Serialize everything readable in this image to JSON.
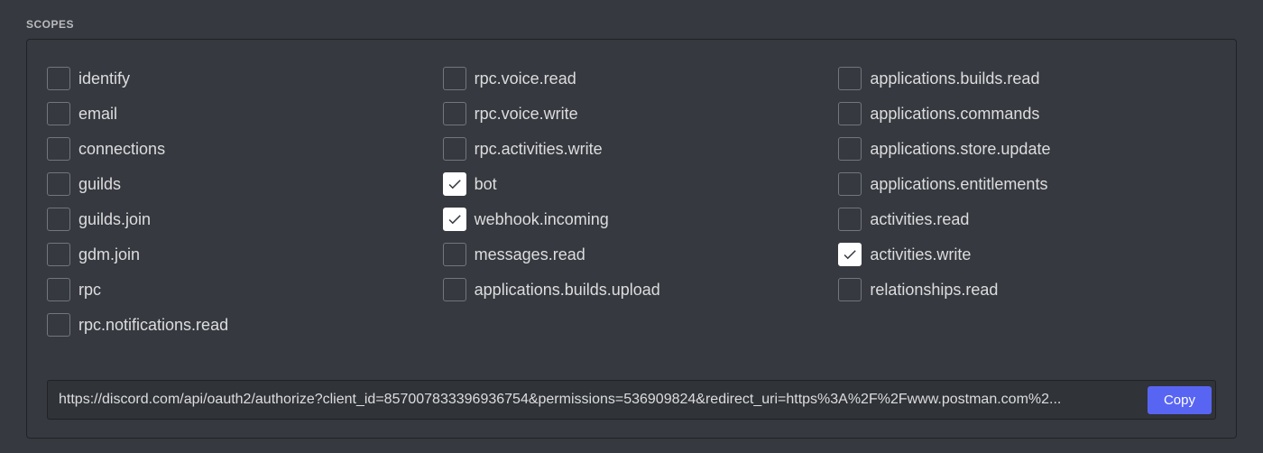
{
  "section_title": "SCOPES",
  "scopes": {
    "col1": [
      {
        "label": "identify",
        "checked": false
      },
      {
        "label": "email",
        "checked": false
      },
      {
        "label": "connections",
        "checked": false
      },
      {
        "label": "guilds",
        "checked": false
      },
      {
        "label": "guilds.join",
        "checked": false
      },
      {
        "label": "gdm.join",
        "checked": false
      },
      {
        "label": "rpc",
        "checked": false
      },
      {
        "label": "rpc.notifications.read",
        "checked": false
      }
    ],
    "col2": [
      {
        "label": "rpc.voice.read",
        "checked": false
      },
      {
        "label": "rpc.voice.write",
        "checked": false
      },
      {
        "label": "rpc.activities.write",
        "checked": false
      },
      {
        "label": "bot",
        "checked": true
      },
      {
        "label": "webhook.incoming",
        "checked": true
      },
      {
        "label": "messages.read",
        "checked": false
      },
      {
        "label": "applications.builds.upload",
        "checked": false
      }
    ],
    "col3": [
      {
        "label": "applications.builds.read",
        "checked": false
      },
      {
        "label": "applications.commands",
        "checked": false
      },
      {
        "label": "applications.store.update",
        "checked": false
      },
      {
        "label": "applications.entitlements",
        "checked": false
      },
      {
        "label": "activities.read",
        "checked": false
      },
      {
        "label": "activities.write",
        "checked": true
      },
      {
        "label": "relationships.read",
        "checked": false
      }
    ]
  },
  "url_value": "https://discord.com/api/oauth2/authorize?client_id=857007833396936754&permissions=536909824&redirect_uri=https%3A%2F%2Fwww.postman.com%2...",
  "copy_label": "Copy"
}
